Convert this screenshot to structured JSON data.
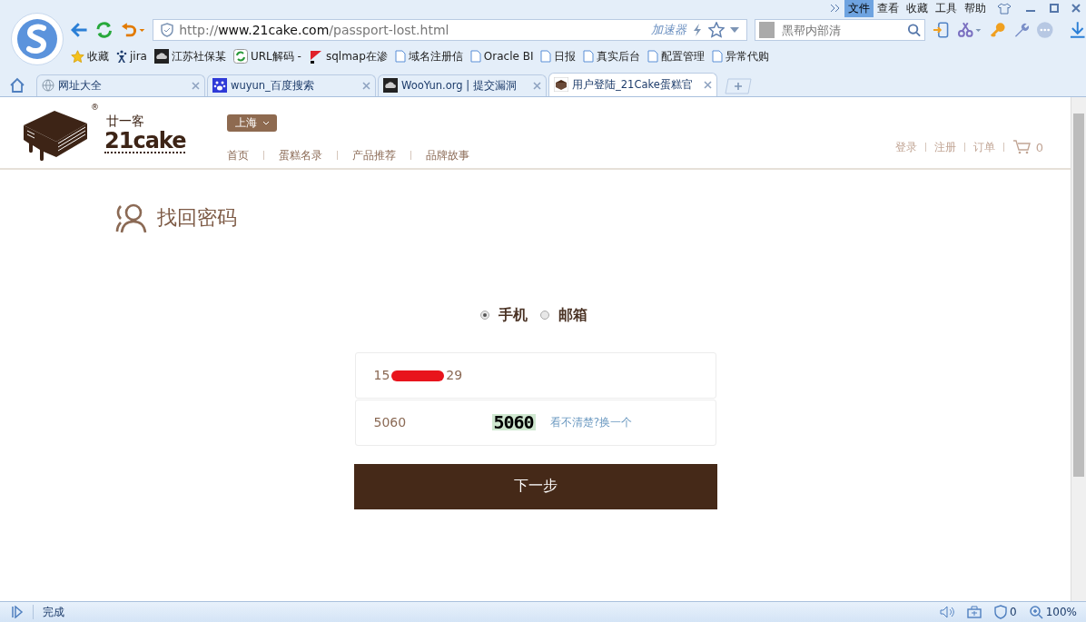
{
  "menu": [
    {
      "label": "文件",
      "selected": true
    },
    {
      "label": "查看",
      "selected": false
    },
    {
      "label": "收藏",
      "selected": false
    },
    {
      "label": "工具",
      "selected": false
    },
    {
      "label": "帮助",
      "selected": false
    }
  ],
  "address_bar": {
    "url_prefix": "http://",
    "url_host": "www.21cake.com",
    "url_path": "/passport-lost.html",
    "accelerator": "加速器"
  },
  "search": {
    "placeholder": "黑帮内部清"
  },
  "bookmarks": [
    {
      "label": "收藏",
      "kind": "star"
    },
    {
      "label": "jira",
      "kind": "jira"
    },
    {
      "label": "江苏社保某",
      "kind": "cloud"
    },
    {
      "label": "URL解码 -",
      "kind": "swap"
    },
    {
      "label": "sqlmap在渗",
      "kind": "flag"
    },
    {
      "label": "域名注册信",
      "kind": "page"
    },
    {
      "label": "Oracle BI",
      "kind": "page"
    },
    {
      "label": "日报",
      "kind": "page"
    },
    {
      "label": "真实后台",
      "kind": "page"
    },
    {
      "label": "配置管理",
      "kind": "page"
    },
    {
      "label": "异常代购",
      "kind": "page"
    }
  ],
  "tabs": [
    {
      "label": "网址大全",
      "kind": "globe",
      "selected": false
    },
    {
      "label": "wuyun_百度搜索",
      "kind": "paw",
      "selected": false
    },
    {
      "label": "WooYun.org | 提交漏洞",
      "kind": "cloud",
      "selected": false
    },
    {
      "label": "用户登陆_21Cake蛋糕官",
      "kind": "cake",
      "selected": true
    }
  ],
  "site": {
    "logo_cn": "廿一客",
    "logo_mark": "®",
    "logo_en": "21cake",
    "city": "上海",
    "nav": [
      "首页",
      "蛋糕名录",
      "产品推荐",
      "品牌故事"
    ],
    "user_links": [
      "登录",
      "注册",
      "订单"
    ],
    "cart_count": "0"
  },
  "page_title": "找回密码",
  "methods": [
    {
      "label": "手机",
      "selected": true
    },
    {
      "label": "邮箱",
      "selected": false
    }
  ],
  "phone_field": {
    "value_start": "15",
    "value_end": "29"
  },
  "captcha_field": {
    "value": "5060",
    "captcha_text": "5060",
    "refresh_link": "看不清楚?换一个"
  },
  "next_button": "下一步",
  "status_bar": {
    "text": "完成",
    "ad_count": "0",
    "zoom": "100%"
  }
}
